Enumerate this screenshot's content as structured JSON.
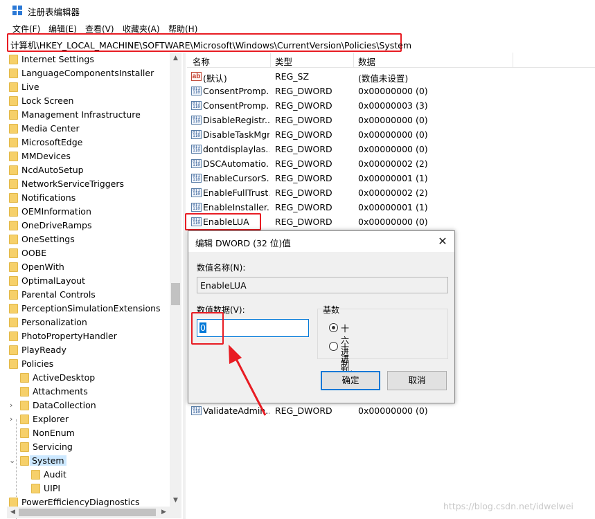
{
  "window": {
    "title": "注册表编辑器"
  },
  "menu": [
    "文件(F)",
    "编辑(E)",
    "查看(V)",
    "收藏夹(A)",
    "帮助(H)"
  ],
  "address": "计算机\\HKEY_LOCAL_MACHINE\\SOFTWARE\\Microsoft\\Windows\\CurrentVersion\\Policies\\System",
  "tree": [
    "Internet Settings",
    "LanguageComponentsInstaller",
    "Live",
    "Lock Screen",
    "Management Infrastructure",
    "Media Center",
    "MicrosoftEdge",
    "MMDevices",
    "NcdAutoSetup",
    "NetworkServiceTriggers",
    "Notifications",
    "OEMInformation",
    "OneDriveRamps",
    "OneSettings",
    "OOBE",
    "OpenWith",
    "OptimalLayout",
    "Parental Controls",
    "PerceptionSimulationExtensions",
    "Personalization",
    "PhotoPropertyHandler",
    "PlayReady",
    "Policies",
    "ActiveDesktop",
    "Attachments",
    "DataCollection",
    "Explorer",
    "NonEnum",
    "Servicing",
    "System",
    "Audit",
    "UIPI",
    "PowerEfficiencyDiagnostics"
  ],
  "list": {
    "headers": {
      "name": "名称",
      "type": "类型",
      "data": "数据"
    },
    "rows": [
      {
        "name": "(默认)",
        "type": "REG_SZ",
        "data": "(数值未设置)",
        "icon": "string-value-icon"
      },
      {
        "name": "ConsentPromp...",
        "type": "REG_DWORD",
        "data": "0x00000000 (0)",
        "icon": "dword-value-icon"
      },
      {
        "name": "ConsentPromp...",
        "type": "REG_DWORD",
        "data": "0x00000003 (3)",
        "icon": "dword-value-icon"
      },
      {
        "name": "DisableRegistr...",
        "type": "REG_DWORD",
        "data": "0x00000000 (0)",
        "icon": "dword-value-icon"
      },
      {
        "name": "DisableTaskMgr",
        "type": "REG_DWORD",
        "data": "0x00000000 (0)",
        "icon": "dword-value-icon"
      },
      {
        "name": "dontdisplaylas...",
        "type": "REG_DWORD",
        "data": "0x00000000 (0)",
        "icon": "dword-value-icon"
      },
      {
        "name": "DSCAutomatio...",
        "type": "REG_DWORD",
        "data": "0x00000002 (2)",
        "icon": "dword-value-icon"
      },
      {
        "name": "EnableCursorS...",
        "type": "REG_DWORD",
        "data": "0x00000001 (1)",
        "icon": "dword-value-icon"
      },
      {
        "name": "EnableFullTrust...",
        "type": "REG_DWORD",
        "data": "0x00000002 (2)",
        "icon": "dword-value-icon"
      },
      {
        "name": "EnableInstaller...",
        "type": "REG_DWORD",
        "data": "0x00000001 (1)",
        "icon": "dword-value-icon"
      },
      {
        "name": "EnableLUA",
        "type": "REG_DWORD",
        "data": "0x00000000 (0)",
        "icon": "dword-value-icon"
      },
      {
        "name": "ValidateAdmin...",
        "type": "REG_DWORD",
        "data": "0x00000000 (0)",
        "icon": "dword-value-icon"
      }
    ]
  },
  "dialog": {
    "title": "编辑 DWORD (32 位)值",
    "name_label": "数值名称(N):",
    "name_value": "EnableLUA",
    "data_label": "数值数据(V):",
    "data_value": "0",
    "base_label": "基数",
    "radio_hex": "十六进制(H)",
    "radio_dec": "十进制(D)",
    "ok": "确定",
    "cancel": "取消",
    "selected_base": "hex"
  },
  "watermark": "https://blog.csdn.net/idwelwei",
  "colors": {
    "highlight": "#e81c23",
    "accent": "#0078d7",
    "selected_tree": "#cce8ff"
  }
}
